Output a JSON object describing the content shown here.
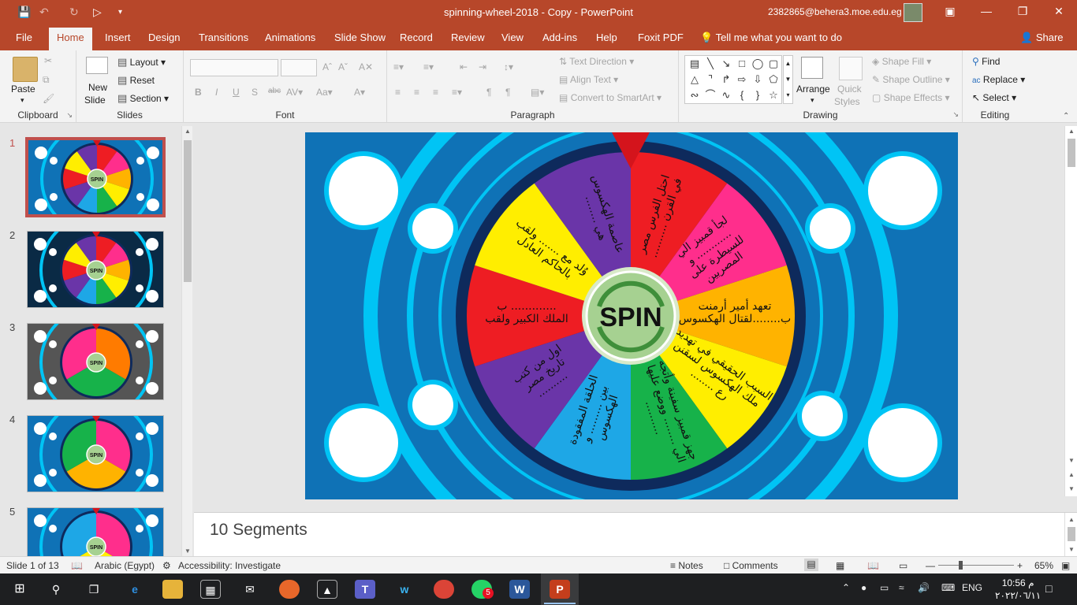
{
  "window": {
    "title": "spinning-wheel-2018 - Copy  -  PowerPoint",
    "account": "2382865@behera3.moe.edu.eg"
  },
  "menu": {
    "tabs": [
      "File",
      "Home",
      "Insert",
      "Design",
      "Transitions",
      "Animations",
      "Slide Show",
      "Record",
      "Review",
      "View",
      "Add-ins",
      "Help",
      "Foxit PDF"
    ],
    "active_tab": "Home",
    "tell_me": "Tell me what you want to do",
    "share": "Share"
  },
  "ribbon": {
    "clipboard": {
      "label": "Clipboard",
      "paste": "Paste"
    },
    "slides": {
      "label": "Slides",
      "new_slide_1": "New",
      "new_slide_2": "Slide",
      "layout": "Layout",
      "reset": "Reset",
      "section": "Section"
    },
    "font": {
      "label": "Font"
    },
    "paragraph": {
      "label": "Paragraph",
      "text_direction": "Text Direction",
      "align_text": "Align Text",
      "convert": "Convert to SmartArt"
    },
    "drawing": {
      "label": "Drawing",
      "arrange": "Arrange",
      "quick_styles_1": "Quick",
      "quick_styles_2": "Styles",
      "shape_fill": "Shape Fill",
      "shape_outline": "Shape Outline",
      "shape_effects": "Shape Effects"
    },
    "editing": {
      "label": "Editing",
      "find": "Find",
      "replace": "Replace",
      "select": "Select"
    }
  },
  "thumbnails": [
    {
      "num": "1",
      "style": "wheel10",
      "bg": "#0f72b6"
    },
    {
      "num": "2",
      "style": "wheel10",
      "bg": "#0a2a45"
    },
    {
      "num": "3",
      "style": "wheel3",
      "bg": "#555555"
    },
    {
      "num": "4",
      "style": "wheel3b",
      "bg": "#0f72b6"
    },
    {
      "num": "5",
      "style": "wheel3c",
      "bg": "#0f72b6"
    }
  ],
  "slide": {
    "center_label": "SPIN",
    "background": "#0f72b6",
    "segments": [
      {
        "color": "#ee1d23",
        "text": [
          "احتل الفرس مصر",
          "في القرن .........."
        ]
      },
      {
        "color": "#ff2e8c",
        "text": [
          "لجأ قمبيز الي",
          "............ و",
          "للسيطرة على",
          "المصريين"
        ]
      },
      {
        "color": "#ffb300",
        "text": [
          "تعهد أمير أرمنت",
          "ب........لقتال الهكسوس"
        ]
      },
      {
        "color": "#ffee00",
        "text": [
          "السبب الحقيقي في تهديد",
          "ملك الهكسوس لسقنن",
          "رع ........"
        ]
      },
      {
        "color": "#17b24a",
        "text": [
          "جهز قمبيز سفينة وأتجه",
          "الي ........ ووضع عليها",
          ".........."
        ]
      },
      {
        "color": "#1ea7e6",
        "text": [
          "الحلقة المفقودة",
          "بين ......... و",
          "الهكسوس"
        ]
      },
      {
        "color": "#6a35a8",
        "text": [
          "اول من كتب",
          "تاريخ مصر",
          ".........."
        ]
      },
      {
        "color": "#ee1d23",
        "text": [
          "............. ب",
          "الملك الكبير ولقب"
        ]
      },
      {
        "color": "#ffee00",
        "text": [
          "وُلد مع ....... ولقب",
          "بالحاكم العادل"
        ]
      },
      {
        "color": "#6a35a8",
        "text": [
          "عاصمة الهكسوس",
          "هي ........"
        ]
      }
    ]
  },
  "notes": {
    "text": "10 Segments"
  },
  "status": {
    "slide_of": "Slide 1 of 13",
    "language": "Arabic (Egypt)",
    "accessibility": "Accessibility: Investigate",
    "notes": "Notes",
    "comments": "Comments",
    "zoom": "65%"
  },
  "taskbar": {
    "lang": "ENG",
    "time": "10:56 م",
    "date": "٢٠٢٢/٠٦/١١",
    "whatsapp_badge": "5"
  }
}
